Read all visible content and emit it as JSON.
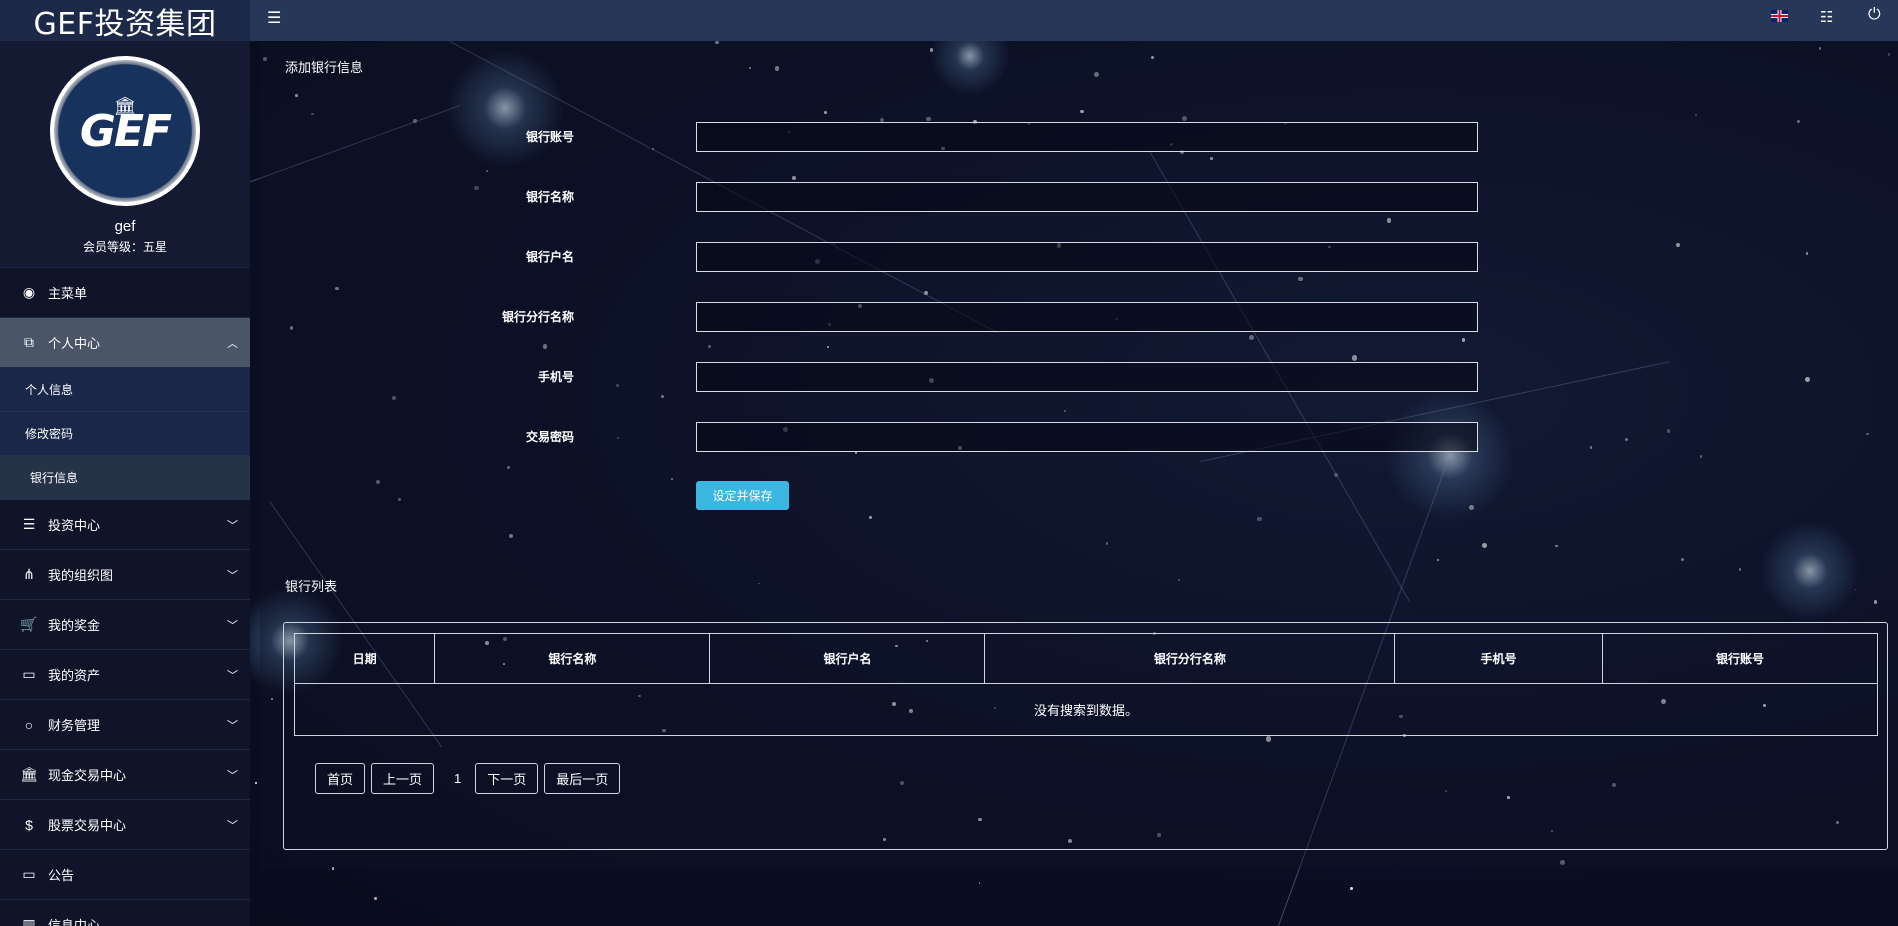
{
  "brand": {
    "title": "GEF投资集团"
  },
  "profile": {
    "logo_text": "GEF",
    "username": "gef",
    "level": "会员等级：五星"
  },
  "sidebar": {
    "items": [
      {
        "label": "主菜单",
        "icon": "dashboard-icon"
      },
      {
        "label": "个人中心",
        "icon": "copy-icon",
        "expanded": true
      },
      {
        "label": "个人信息"
      },
      {
        "label": "修改密码"
      },
      {
        "label": "银行信息",
        "active": true
      },
      {
        "label": "投资中心",
        "icon": "database-icon"
      },
      {
        "label": "我的组织图",
        "icon": "sitemap-icon"
      },
      {
        "label": "我的奖金",
        "icon": "cart-icon"
      },
      {
        "label": "我的资产",
        "icon": "credit-card-icon"
      },
      {
        "label": "财务管理",
        "icon": "circle-icon"
      },
      {
        "label": "现金交易中心",
        "icon": "bank-icon"
      },
      {
        "label": "股票交易中心",
        "icon": "dollar-icon"
      },
      {
        "label": "公告",
        "icon": "monitor-icon"
      },
      {
        "label": "信息中心",
        "icon": "chart-icon"
      }
    ]
  },
  "topbar": {
    "icons": [
      "menu-toggle-icon",
      "uk-flag-icon",
      "tasks-icon",
      "power-icon"
    ]
  },
  "form": {
    "title": "添加银行信息",
    "fields": [
      {
        "label": "银行账号",
        "value": ""
      },
      {
        "label": "银行名称",
        "value": ""
      },
      {
        "label": "银行户名",
        "value": ""
      },
      {
        "label": "银行分行名称",
        "value": ""
      },
      {
        "label": "手机号",
        "value": ""
      },
      {
        "label": "交易密码",
        "value": ""
      }
    ],
    "save_label": "设定并保存"
  },
  "list": {
    "title": "银行列表",
    "columns": [
      "日期",
      "银行名称",
      "银行户名",
      "银行分行名称",
      "手机号",
      "银行账号"
    ],
    "empty_text": "没有搜索到数据。",
    "pager": {
      "first": "首页",
      "prev": "上一页",
      "page": "1",
      "next": "下一页",
      "last": "最后一页"
    }
  },
  "colors": {
    "accent": "#3ab6e0",
    "topbar": "#26375a",
    "sidebar": "#0f1428"
  }
}
